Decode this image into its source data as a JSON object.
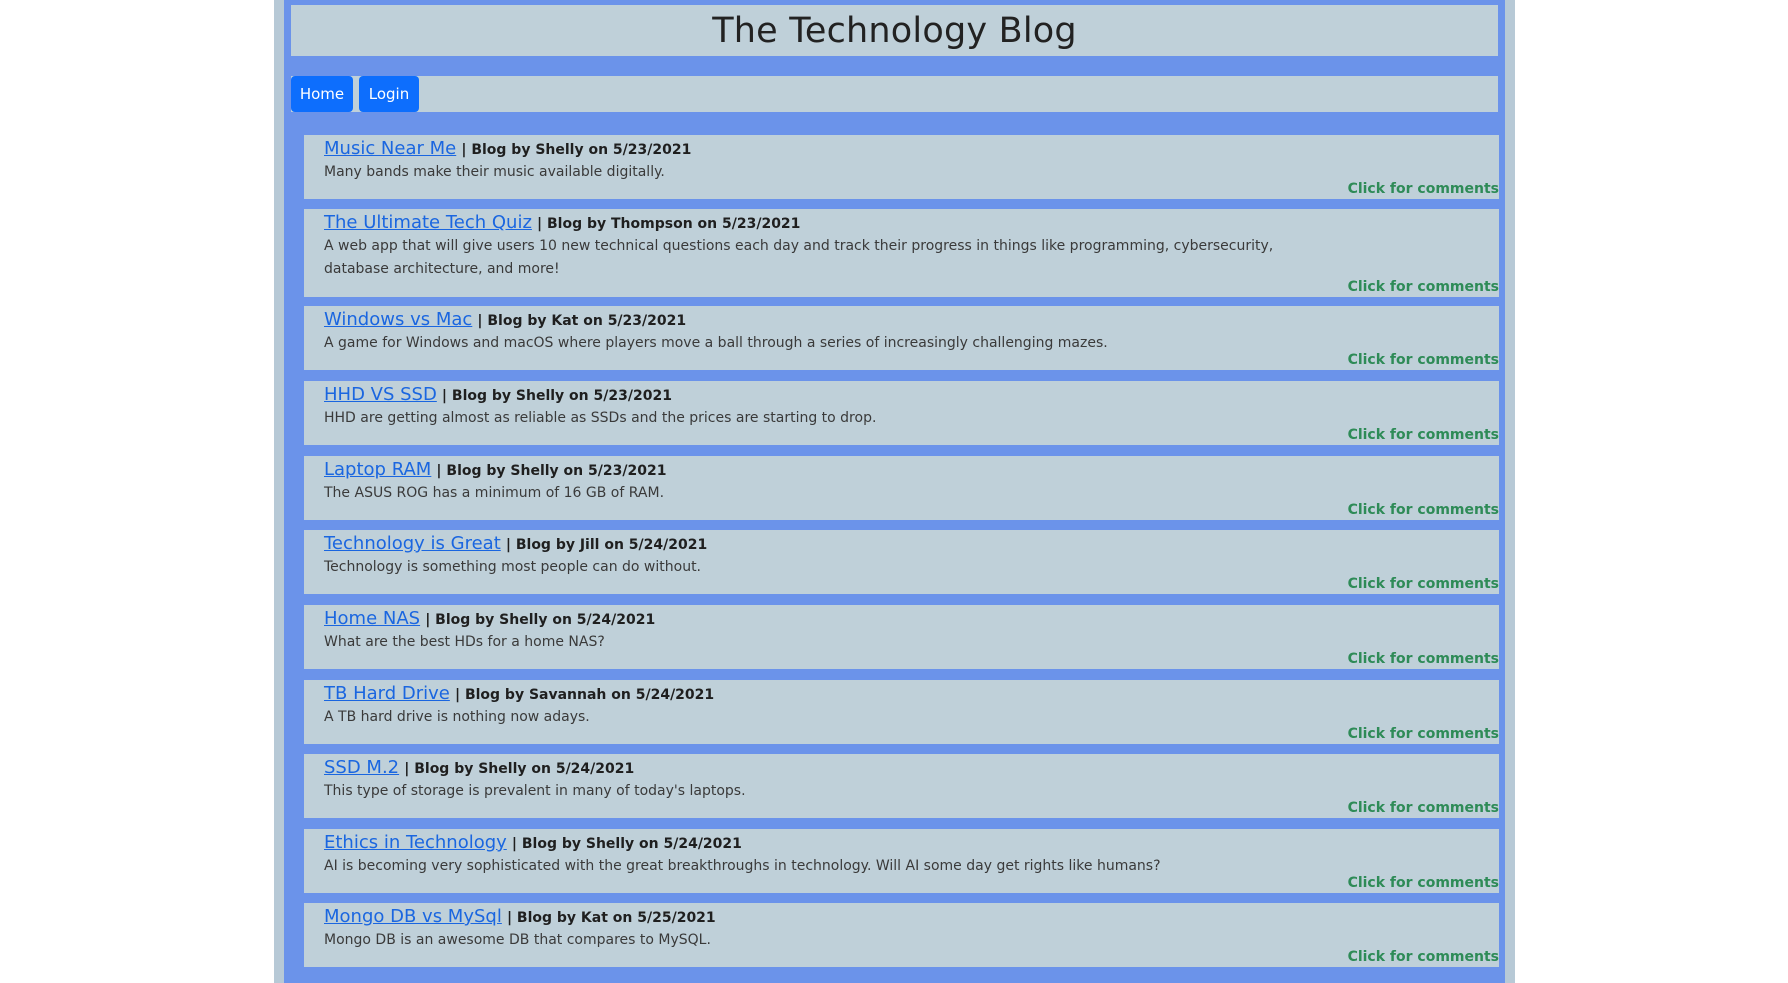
{
  "header": {
    "title": "The Technology Blog"
  },
  "nav": {
    "home_label": "Home",
    "login_label": "Login"
  },
  "posts": [
    {
      "title": "Music Near Me",
      "meta": "| Blog by Shelly on 5/23/2021",
      "description": "Many bands make their music available digitally.",
      "comments_label": "Click for comments"
    },
    {
      "title": "The Ultimate Tech Quiz",
      "meta": "| Blog by Thompson on 5/23/2021",
      "description": "A web app that will give users 10 new technical questions each day and track their progress in things like programming, cybersecurity, database architecture, and more!",
      "comments_label": "Click for comments"
    },
    {
      "title": "Windows vs Mac",
      "meta": "| Blog by Kat on 5/23/2021",
      "description": "A game for Windows and macOS where players move a ball through a series of increasingly challenging mazes.",
      "comments_label": "Click for comments"
    },
    {
      "title": "HHD VS SSD",
      "meta": "| Blog by Shelly on 5/23/2021",
      "description": "HHD are getting almost as reliable as SSDs and the prices are starting to drop.",
      "comments_label": "Click for comments"
    },
    {
      "title": "Laptop RAM",
      "meta": "| Blog by Shelly on 5/23/2021",
      "description": "The ASUS ROG has a minimum of 16 GB of RAM.",
      "comments_label": "Click for comments"
    },
    {
      "title": "Technology is Great",
      "meta": "| Blog by Jill on 5/24/2021",
      "description": "Technology is something most people can do without.",
      "comments_label": "Click for comments"
    },
    {
      "title": "Home NAS",
      "meta": "| Blog by Shelly on 5/24/2021",
      "description": "What are the best HDs for a home NAS?",
      "comments_label": "Click for comments"
    },
    {
      "title": "TB Hard Drive",
      "meta": "| Blog by Savannah on 5/24/2021",
      "description": "A TB hard drive is nothing now adays.",
      "comments_label": "Click for comments"
    },
    {
      "title": "SSD M.2",
      "meta": "| Blog by Shelly on 5/24/2021",
      "description": "This type of storage is prevalent in many of today's laptops.",
      "comments_label": "Click for comments"
    },
    {
      "title": "Ethics in Technology",
      "meta": "| Blog by Shelly on 5/24/2021",
      "description": "AI is becoming very sophisticated with the great breakthroughs in technology. Will AI some day get rights like humans?",
      "comments_label": "Click for comments"
    },
    {
      "title": "Mongo DB vs MySql",
      "meta": "| Blog by Kat on 5/25/2021",
      "description": "Mongo DB is an awesome DB that compares to MySQL.",
      "comments_label": "Click for comments"
    }
  ]
}
